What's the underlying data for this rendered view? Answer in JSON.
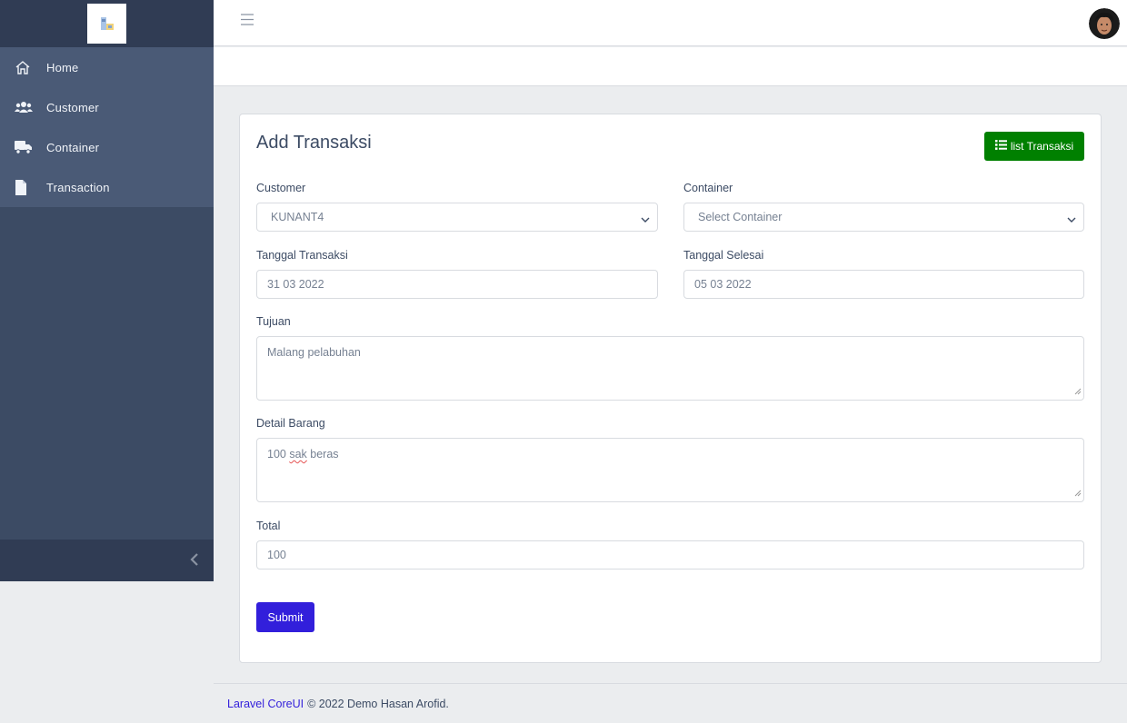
{
  "sidebar": {
    "items": [
      {
        "label": "Home",
        "icon": "home-icon"
      },
      {
        "label": "Customer",
        "icon": "users-icon"
      },
      {
        "label": "Container",
        "icon": "truck-icon"
      },
      {
        "label": "Transaction",
        "icon": "file-icon"
      }
    ],
    "toggle_icon": "chevron-left-icon"
  },
  "header": {
    "menu_icon": "hamburger-icon",
    "avatar_icon": "avatar"
  },
  "form": {
    "title": "Add Transaksi",
    "list_button": "list Transaksi",
    "customer": {
      "label": "Customer",
      "value": "KUNANT4"
    },
    "container": {
      "label": "Container",
      "value": "Select Container"
    },
    "tanggal_transaksi": {
      "label": "Tanggal Transaksi",
      "value": "31 03 2022"
    },
    "tanggal_selesai": {
      "label": "Tanggal Selesai",
      "value": "05 03 2022"
    },
    "tujuan": {
      "label": "Tujuan",
      "value": "Malang pelabuhan"
    },
    "detail_barang": {
      "label": "Detail Barang",
      "value_prefix": "100 ",
      "value_misspelled": "sak",
      "value_suffix": " beras"
    },
    "total": {
      "label": "Total",
      "value": "100"
    },
    "submit": "Submit"
  },
  "footer": {
    "link": "Laravel CoreUI",
    "text": "© 2022 Demo Hasan Arofid."
  },
  "colors": {
    "sidebar": "#3c4b64",
    "primary": "#321fdb",
    "success": "#008000",
    "background": "#ebedef"
  }
}
